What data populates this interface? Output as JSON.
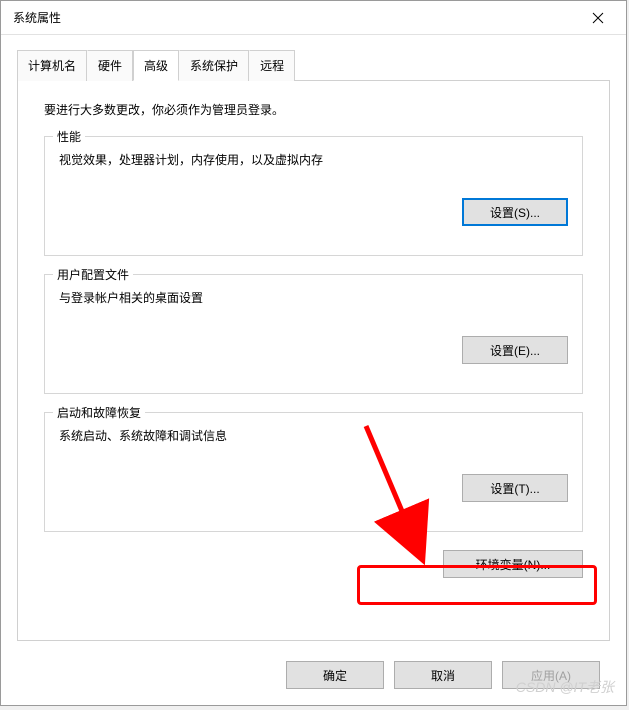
{
  "window": {
    "title": "系统属性"
  },
  "tabs": {
    "items": [
      {
        "label": "计算机名"
      },
      {
        "label": "硬件"
      },
      {
        "label": "高级"
      },
      {
        "label": "系统保护"
      },
      {
        "label": "远程"
      }
    ],
    "active_index": 2
  },
  "intro": "要进行大多数更改，你必须作为管理员登录。",
  "groups": {
    "performance": {
      "title": "性能",
      "desc": "视觉效果，处理器计划，内存使用，以及虚拟内存",
      "button": "设置(S)..."
    },
    "userprofile": {
      "title": "用户配置文件",
      "desc": "与登录帐户相关的桌面设置",
      "button": "设置(E)..."
    },
    "startup": {
      "title": "启动和故障恢复",
      "desc": "系统启动、系统故障和调试信息",
      "button": "设置(T)..."
    }
  },
  "env_button": "环境变量(N)...",
  "footer": {
    "ok": "确定",
    "cancel": "取消",
    "apply": "应用(A)"
  },
  "watermark": "CSDN @IT老张"
}
